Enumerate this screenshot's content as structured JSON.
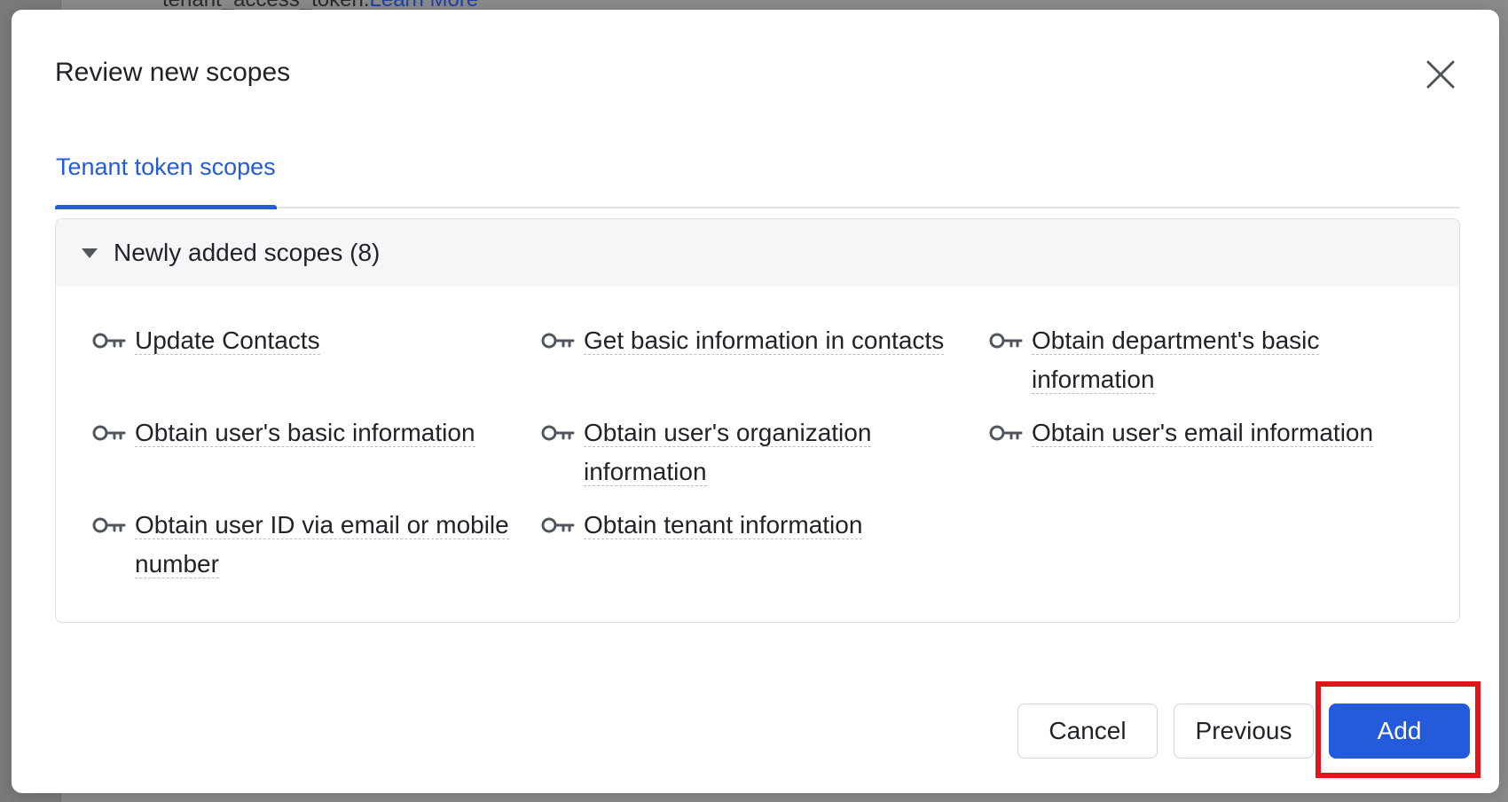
{
  "background": {
    "text": "tenant_access_token.",
    "link": "Learn More"
  },
  "modal": {
    "title": "Review new scopes",
    "close_icon": "close-icon"
  },
  "tabs": [
    {
      "label": "Tenant token scopes",
      "active": true
    }
  ],
  "panel": {
    "title": "Newly added scopes (8)",
    "expanded": true,
    "scopes": [
      {
        "label": "Update Contacts",
        "icon": "key-icon"
      },
      {
        "label": "Get basic information in contacts",
        "icon": "key-icon"
      },
      {
        "label": "Obtain department's basic information",
        "icon": "key-icon"
      },
      {
        "label": "Obtain user's basic information",
        "icon": "key-icon"
      },
      {
        "label": "Obtain user's organization information",
        "icon": "key-icon"
      },
      {
        "label": "Obtain user's email information",
        "icon": "key-icon"
      },
      {
        "label": "Obtain user ID via email or mobile number",
        "icon": "key-icon"
      },
      {
        "label": "Obtain tenant information",
        "icon": "key-icon"
      }
    ]
  },
  "footer": {
    "cancel_label": "Cancel",
    "previous_label": "Previous",
    "add_label": "Add"
  },
  "colors": {
    "primary": "#245bdb",
    "highlight": "#e3141c",
    "text": "#1f2329"
  }
}
